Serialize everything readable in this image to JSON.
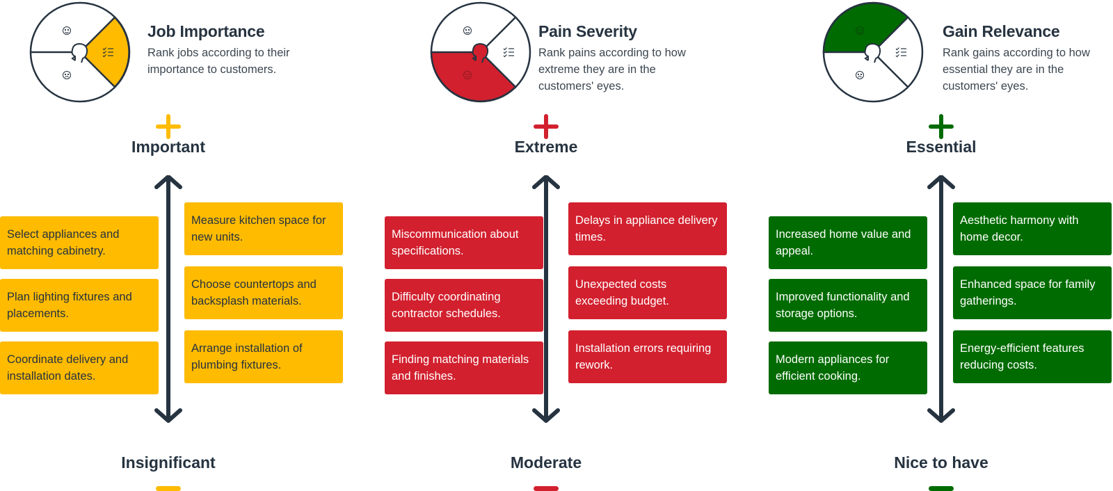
{
  "colors": {
    "jobs": "#FFBB00",
    "pains": "#D2202E",
    "gains": "#006B00",
    "text_dark": "#263340"
  },
  "columns": [
    {
      "key": "jobs",
      "title": "Job Importance",
      "description": "Rank jobs according to their importance to customers.",
      "wheel_highlight": "jobs-checklist-segment",
      "top_marker_icon": "plus-icon",
      "top_label": "Important",
      "bottom_label": "Insignificant",
      "bottom_marker_icon": "minus-icon",
      "left_cards": [
        "Select appliances and matching cabinetry.",
        "Plan lighting fixtures and placements.",
        "Coordinate delivery and installation dates."
      ],
      "right_cards": [
        "Measure kitchen space for new units.",
        "Choose countertops and backsplash materials.",
        "Arrange installation of plumbing fixtures."
      ]
    },
    {
      "key": "pains",
      "title": "Pain Severity",
      "description": "Rank pains according to how extreme they are in the customers' eyes.",
      "wheel_highlight": "pains-sad-face-segment",
      "top_marker_icon": "plus-icon",
      "top_label": "Extreme",
      "bottom_label": "Moderate",
      "bottom_marker_icon": "minus-icon",
      "left_cards": [
        "Miscommunication about specifications.",
        "Difficulty coordinating contractor schedules.",
        "Finding matching materials and finishes."
      ],
      "right_cards": [
        "Delays in appliance delivery times.",
        "Unexpected costs exceeding budget.",
        "Installation errors requiring rework."
      ]
    },
    {
      "key": "gains",
      "title": "Gain Relevance",
      "description": "Rank gains according to how essential they are in the customers' eyes.",
      "wheel_highlight": "gains-happy-face-segment",
      "top_marker_icon": "plus-icon",
      "top_label": "Essential",
      "bottom_label": "Nice to have",
      "bottom_marker_icon": "minus-icon",
      "left_cards": [
        "Increased home value and appeal.",
        "Improved functionality and storage options.",
        "Modern appliances for efficient cooking."
      ],
      "right_cards": [
        "Aesthetic harmony with home decor.",
        "Enhanced space for family gatherings.",
        "Energy-efficient features reducing costs."
      ]
    }
  ]
}
